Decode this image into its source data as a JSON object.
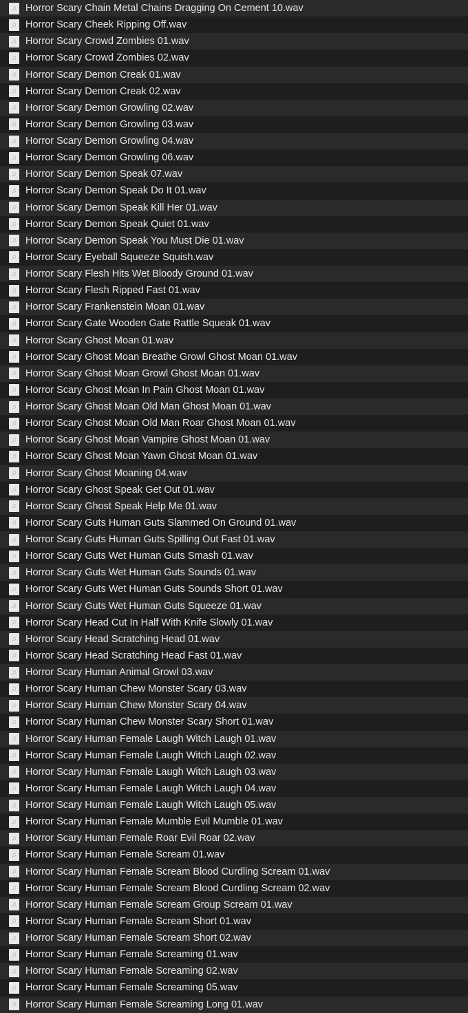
{
  "file_icon": "audio-file-icon",
  "files": [
    "Horror Scary Chain Metal Chains Dragging On Cement 10.wav",
    "Horror Scary Cheek Ripping Off.wav",
    "Horror Scary Crowd Zombies 01.wav",
    "Horror Scary Crowd Zombies 02.wav",
    "Horror Scary Demon Creak 01.wav",
    "Horror Scary Demon Creak 02.wav",
    "Horror Scary Demon Growling 02.wav",
    "Horror Scary Demon Growling 03.wav",
    "Horror Scary Demon Growling 04.wav",
    "Horror Scary Demon Growling 06.wav",
    "Horror Scary Demon Speak 07.wav",
    "Horror Scary Demon Speak Do It 01.wav",
    "Horror Scary Demon Speak Kill Her 01.wav",
    "Horror Scary Demon Speak Quiet 01.wav",
    "Horror Scary Demon Speak You Must Die 01.wav",
    "Horror Scary Eyeball Squeeze Squish.wav",
    "Horror Scary Flesh Hits Wet Bloody Ground 01.wav",
    "Horror Scary Flesh Ripped Fast 01.wav",
    "Horror Scary Frankenstein Moan 01.wav",
    "Horror Scary Gate Wooden Gate Rattle Squeak 01.wav",
    "Horror Scary Ghost Moan 01.wav",
    "Horror Scary Ghost Moan Breathe Growl Ghost Moan 01.wav",
    "Horror Scary Ghost Moan Growl Ghost Moan 01.wav",
    "Horror Scary Ghost Moan In Pain Ghost Moan 01.wav",
    "Horror Scary Ghost Moan Old Man Ghost Moan 01.wav",
    "Horror Scary Ghost Moan Old Man Roar Ghost Moan 01.wav",
    "Horror Scary Ghost Moan Vampire Ghost Moan 01.wav",
    "Horror Scary Ghost Moan Yawn Ghost Moan 01.wav",
    "Horror Scary Ghost Moaning 04.wav",
    "Horror Scary Ghost Speak Get Out 01.wav",
    "Horror Scary Ghost Speak Help Me 01.wav",
    "Horror Scary Guts Human Guts Slammed On Ground 01.wav",
    "Horror Scary Guts Human Guts Spilling Out Fast 01.wav",
    "Horror Scary Guts Wet Human Guts Smash 01.wav",
    "Horror Scary Guts Wet Human Guts Sounds 01.wav",
    "Horror Scary Guts Wet Human Guts Sounds Short 01.wav",
    "Horror Scary Guts Wet Human Guts Squeeze 01.wav",
    "Horror Scary Head Cut In Half With Knife Slowly 01.wav",
    "Horror Scary Head Scratching Head 01.wav",
    "Horror Scary Head Scratching Head Fast 01.wav",
    "Horror Scary Human Animal Growl 03.wav",
    "Horror Scary Human Chew Monster Scary 03.wav",
    "Horror Scary Human Chew Monster Scary 04.wav",
    "Horror Scary Human Chew Monster Scary Short 01.wav",
    "Horror Scary Human Female Laugh Witch Laugh 01.wav",
    "Horror Scary Human Female Laugh Witch Laugh 02.wav",
    "Horror Scary Human Female Laugh Witch Laugh 03.wav",
    "Horror Scary Human Female Laugh Witch Laugh 04.wav",
    "Horror Scary Human Female Laugh Witch Laugh 05.wav",
    "Horror Scary Human Female Mumble Evil Mumble 01.wav",
    "Horror Scary Human Female Roar Evil Roar 02.wav",
    "Horror Scary Human Female Scream 01.wav",
    "Horror Scary Human Female Scream Blood Curdling Scream 01.wav",
    "Horror Scary Human Female Scream Blood Curdling Scream 02.wav",
    "Horror Scary Human Female Scream Group Scream 01.wav",
    "Horror Scary Human Female Scream Short 01.wav",
    "Horror Scary Human Female Scream Short 02.wav",
    "Horror Scary Human Female Screaming 01.wav",
    "Horror Scary Human Female Screaming 02.wav",
    "Horror Scary Human Female Screaming 05.wav",
    "Horror Scary Human Female Screaming Long 01.wav"
  ]
}
